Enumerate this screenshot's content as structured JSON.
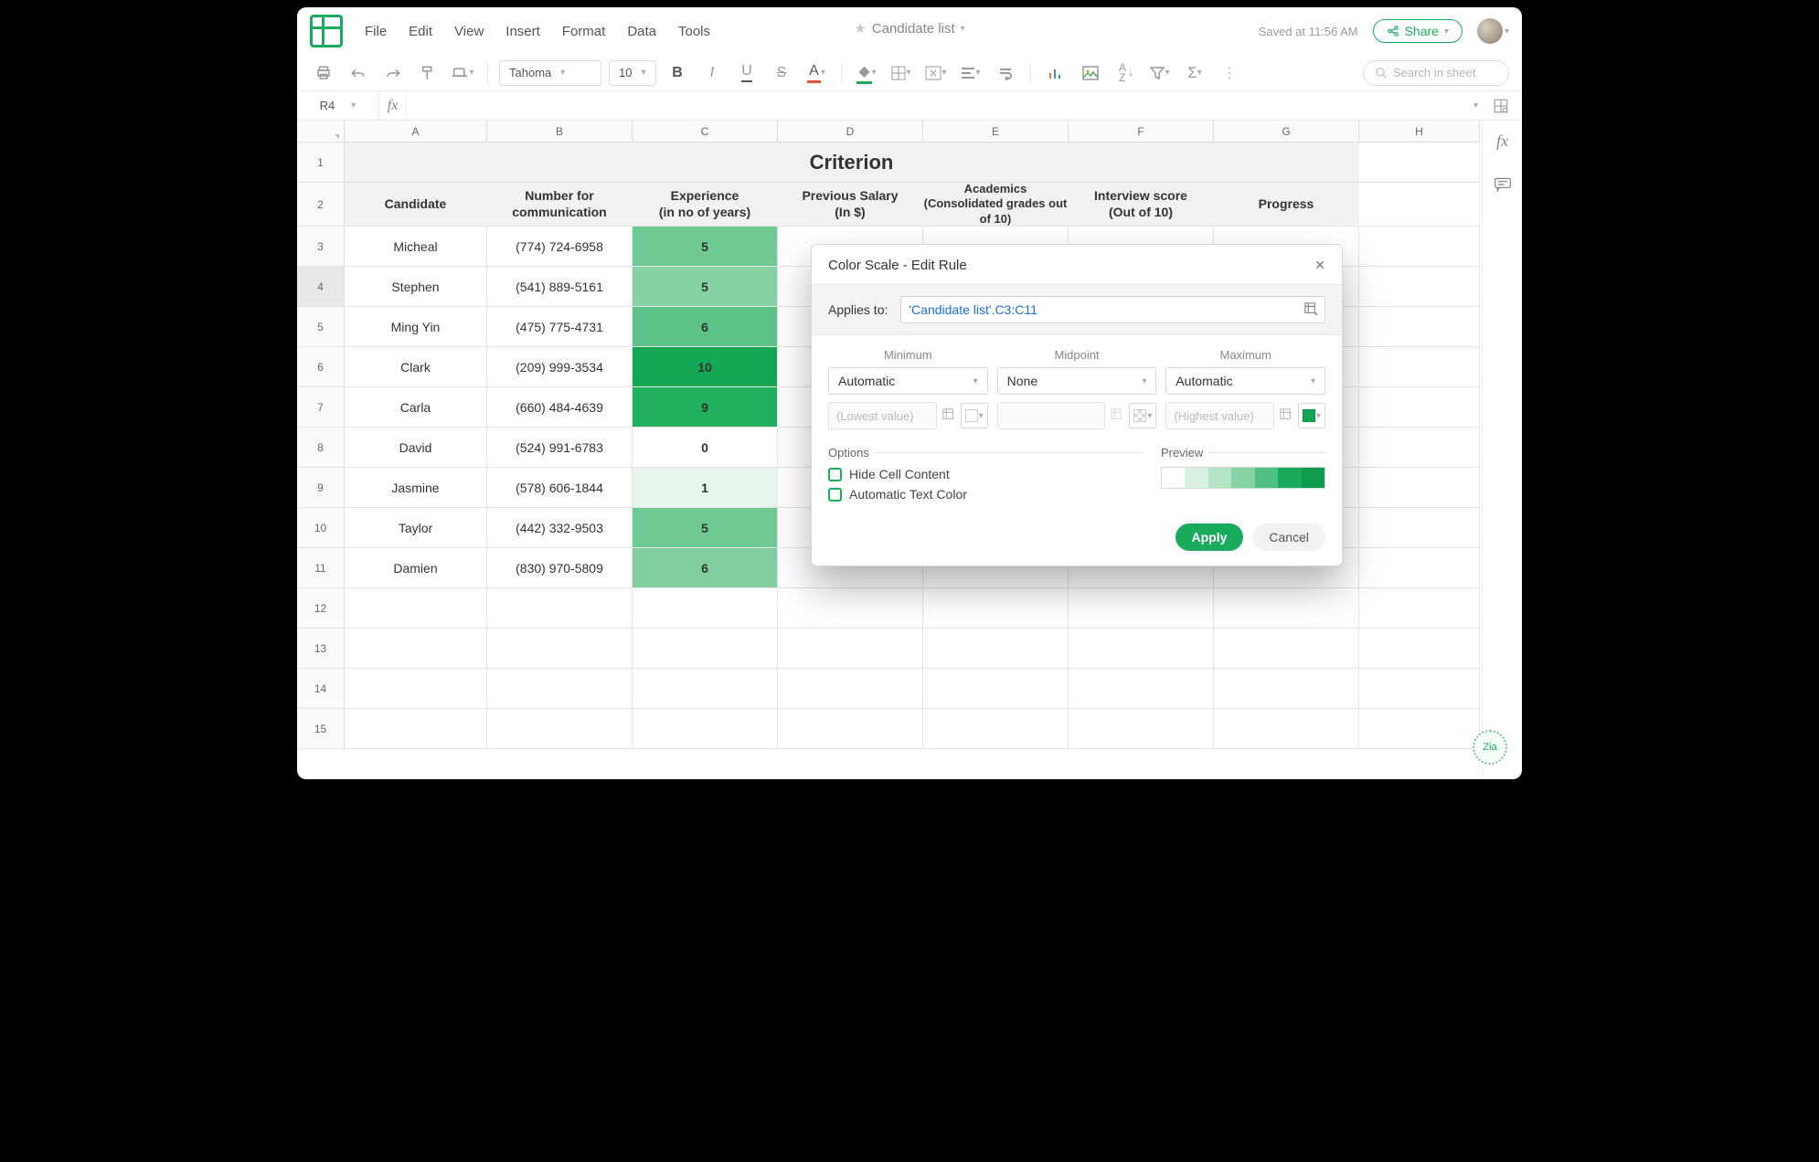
{
  "document": {
    "title": "Candidate list",
    "saved_status": "Saved at 11:56 AM"
  },
  "header": {
    "menus": [
      "File",
      "Edit",
      "View",
      "Insert",
      "Format",
      "Data",
      "Tools"
    ],
    "share_label": "Share"
  },
  "toolbar": {
    "font_name": "Tahoma",
    "font_size": "10",
    "search_placeholder": "Search in sheet"
  },
  "namebox": {
    "cell_ref": "R4",
    "fx": "fx"
  },
  "columns": [
    "A",
    "B",
    "C",
    "D",
    "E",
    "F",
    "G",
    "H"
  ],
  "grid": {
    "criterion_title": "Criterion",
    "headers": {
      "A": "Candidate",
      "B": "Number for communication",
      "C": "Experience\n(in no of years)",
      "D": "Previous Salary\n(In $)",
      "E": "Academics (Consolidated grades out of 10)",
      "F": "Interview score\n(Out of 10)",
      "G": "Progress"
    },
    "rows": [
      {
        "n": 3,
        "candidate": "Micheal",
        "phone": "(774) 724-6958",
        "exp": "5",
        "exp_color": "#6ec993"
      },
      {
        "n": 4,
        "candidate": "Stephen",
        "phone": "(541) 889-5161",
        "exp": "5",
        "exp_color": "#87d2a5",
        "selected": true
      },
      {
        "n": 5,
        "candidate": "Ming Yin",
        "phone": "(475) 775-4731",
        "exp": "6",
        "exp_color": "#5cc287"
      },
      {
        "n": 6,
        "candidate": "Clark",
        "phone": "(209) 999-3534",
        "exp": "10",
        "exp_color": "#14a756"
      },
      {
        "n": 7,
        "candidate": "Carla",
        "phone": "(660) 484-4639",
        "exp": "9",
        "exp_color": "#22af5f"
      },
      {
        "n": 8,
        "candidate": "David",
        "phone": "(524) 991-6783",
        "exp": "0",
        "exp_color": "#ffffff"
      },
      {
        "n": 9,
        "candidate": "Jasmine",
        "phone": "(578) 606-1844",
        "exp": "1",
        "exp_color": "#e7f6ec"
      },
      {
        "n": 10,
        "candidate": "Taylor",
        "phone": "(442) 332-9503",
        "exp": "5",
        "exp_color": "#6ec993"
      },
      {
        "n": 11,
        "candidate": "Damien",
        "phone": "(830) 970-5809",
        "exp": "6",
        "exp_color": "#81cf9f"
      }
    ],
    "blank_row_numbers": [
      12,
      13,
      14,
      15
    ]
  },
  "dialog": {
    "title": "Color Scale - Edit Rule",
    "applies_to_label": "Applies to:",
    "applies_to_value": "'Candidate list'.C3:C11",
    "cols": {
      "minimum": {
        "label": "Minimum",
        "mode": "Automatic",
        "placeholder": "(Lowest value)",
        "swatch": "#ffffff"
      },
      "midpoint": {
        "label": "Midpoint",
        "mode": "None",
        "placeholder": "",
        "swatch": "checker"
      },
      "maximum": {
        "label": "Maximum",
        "mode": "Automatic",
        "placeholder": "(Highest value)",
        "swatch": "#11aa52"
      }
    },
    "options_label": "Options",
    "preview_label": "Preview",
    "hide_cell_label": "Hide Cell Content",
    "auto_text_label": "Automatic Text Color",
    "preview_colors": [
      "#ffffff",
      "#d8f1e1",
      "#b2e4c5",
      "#85d4a5",
      "#4fc183",
      "#1aab5f",
      "#0f9a50"
    ],
    "apply_label": "Apply",
    "cancel_label": "Cancel"
  }
}
